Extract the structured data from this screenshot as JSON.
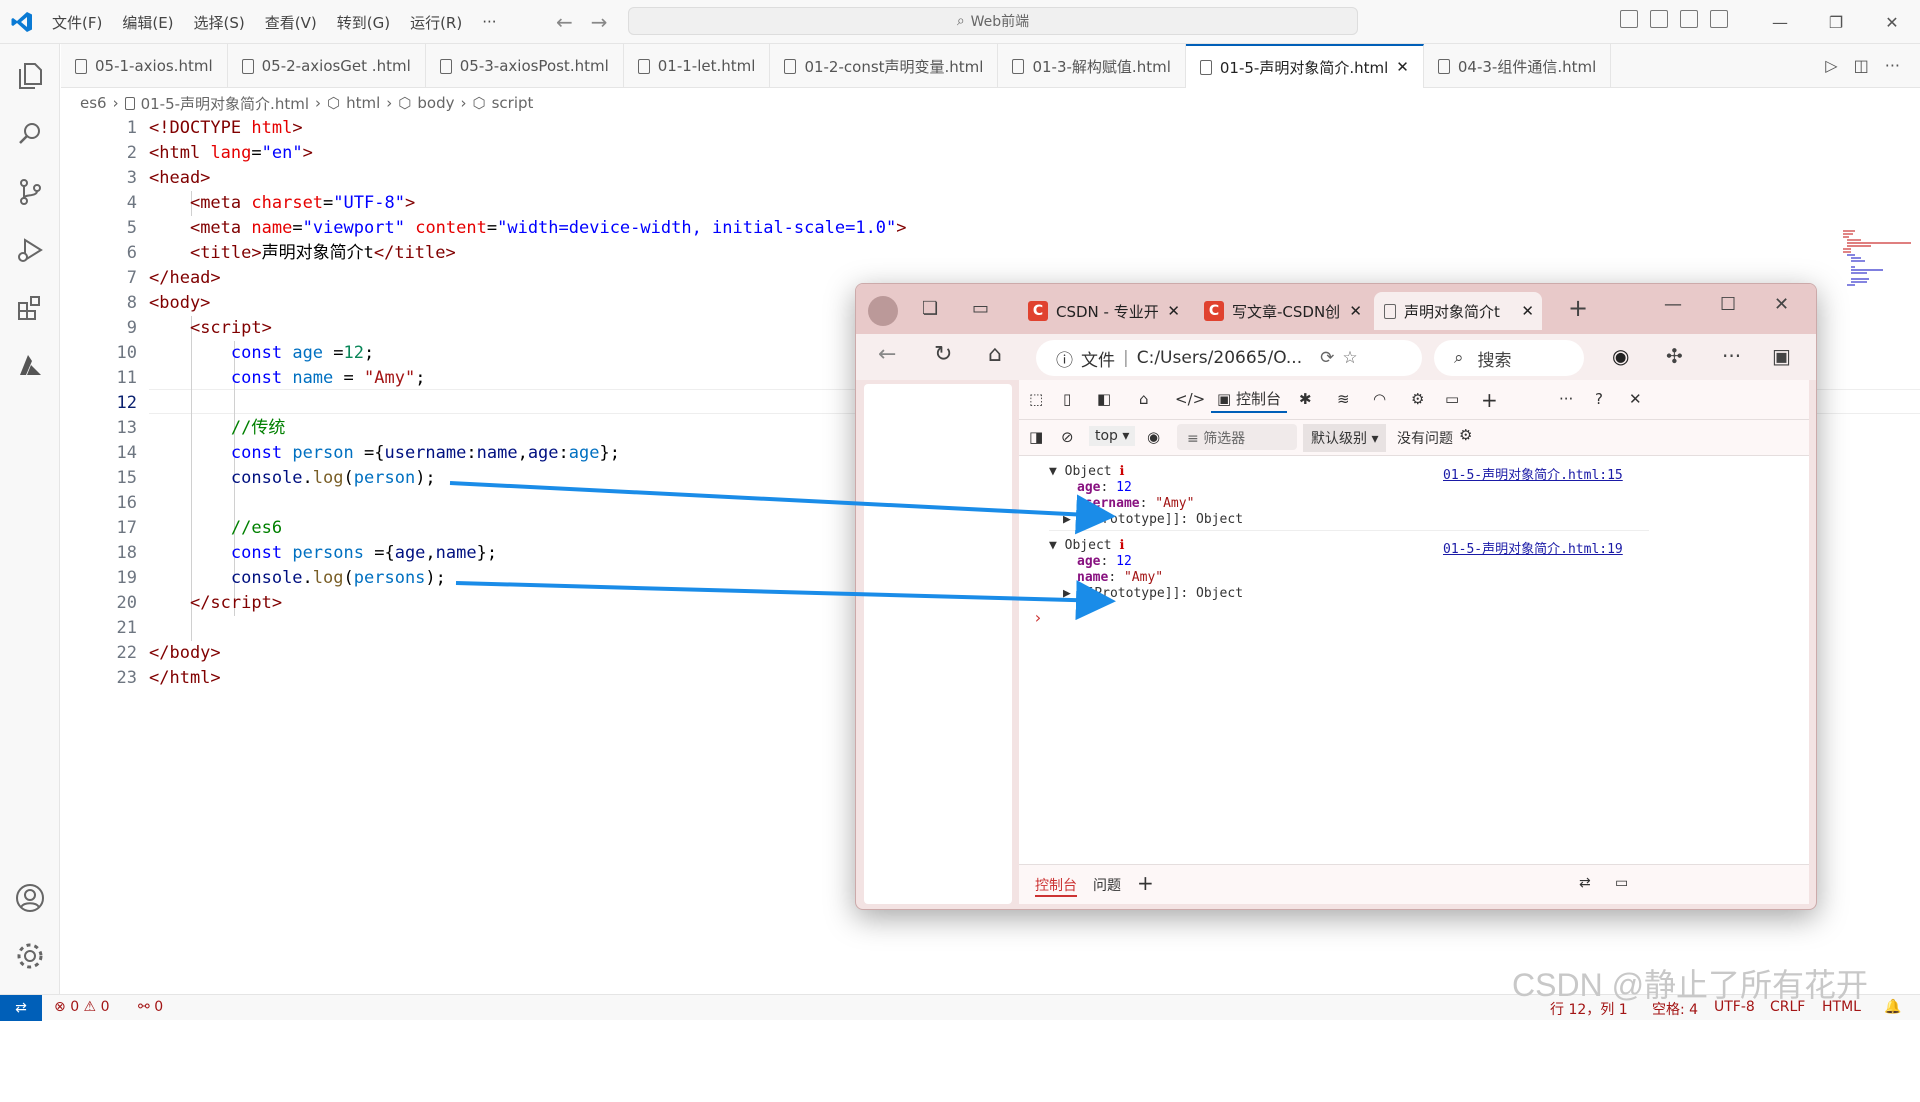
{
  "titlebar": {
    "menus": [
      "文件(F)",
      "编辑(E)",
      "选择(S)",
      "查看(V)",
      "转到(G)",
      "运行(R)",
      "···"
    ],
    "search": "Web前端"
  },
  "tabs": [
    {
      "label": "05-1-axios.html",
      "active": false
    },
    {
      "label": "05-2-axiosGet .html",
      "active": false
    },
    {
      "label": "05-3-axiosPost.html",
      "active": false
    },
    {
      "label": "01-1-let.html",
      "active": false
    },
    {
      "label": "01-2-const声明变量.html",
      "active": false
    },
    {
      "label": "01-3-解构赋值.html",
      "active": false
    },
    {
      "label": "01-5-声明对象简介.html",
      "active": true
    },
    {
      "label": "04-3-组件通信.html",
      "active": false
    }
  ],
  "breadcrumb": [
    "es6",
    "01-5-声明对象简介.html",
    "html",
    "body",
    "script"
  ],
  "code": {
    "current_line": 12,
    "line_numbers": [
      "1",
      "2",
      "3",
      "4",
      "5",
      "6",
      "7",
      "8",
      "9",
      "10",
      "11",
      "12",
      "13",
      "14",
      "15",
      "16",
      "17",
      "18",
      "19",
      "20",
      "21",
      "22",
      "23"
    ]
  },
  "status": {
    "errors": "0",
    "warnings": "0",
    "ports": "0",
    "position": "行 12，列 1",
    "spaces": "空格: 4",
    "encoding": "UTF-8",
    "eol": "CRLF",
    "language": "HTML"
  },
  "watermark": "CSDN @静止了所有花开",
  "browser": {
    "tabs": [
      {
        "label": "CSDN - 专业开",
        "active": false
      },
      {
        "label": "写文章-CSDN创",
        "active": false
      },
      {
        "label": "声明对象简介t",
        "active": true
      }
    ],
    "address_prefix": "文件",
    "address": "C:/Users/20665/O...",
    "search": "搜索",
    "devtools": {
      "console_tab": "控制台",
      "context": "top",
      "filter_placeholder": "筛选器",
      "level": "默认级别",
      "issues": "没有问题",
      "bottom_tabs": [
        "控制台",
        "问题"
      ],
      "logs": [
        {
          "type": "Object",
          "source": "01-5-声明对象简介.html:15",
          "props": [
            {
              "k": "age",
              "v": "12"
            },
            {
              "k": "username",
              "v": "\"Amy\""
            }
          ],
          "proto": "[[Prototype]]: Object"
        },
        {
          "type": "Object",
          "source": "01-5-声明对象简介.html:19",
          "props": [
            {
              "k": "age",
              "v": "12"
            },
            {
              "k": "name",
              "v": "\"Amy\""
            }
          ],
          "proto": "[[Prototype]]: Object"
        }
      ]
    }
  },
  "colors": {
    "accent": "#005fb8",
    "arrow": "#1a8ce8"
  }
}
